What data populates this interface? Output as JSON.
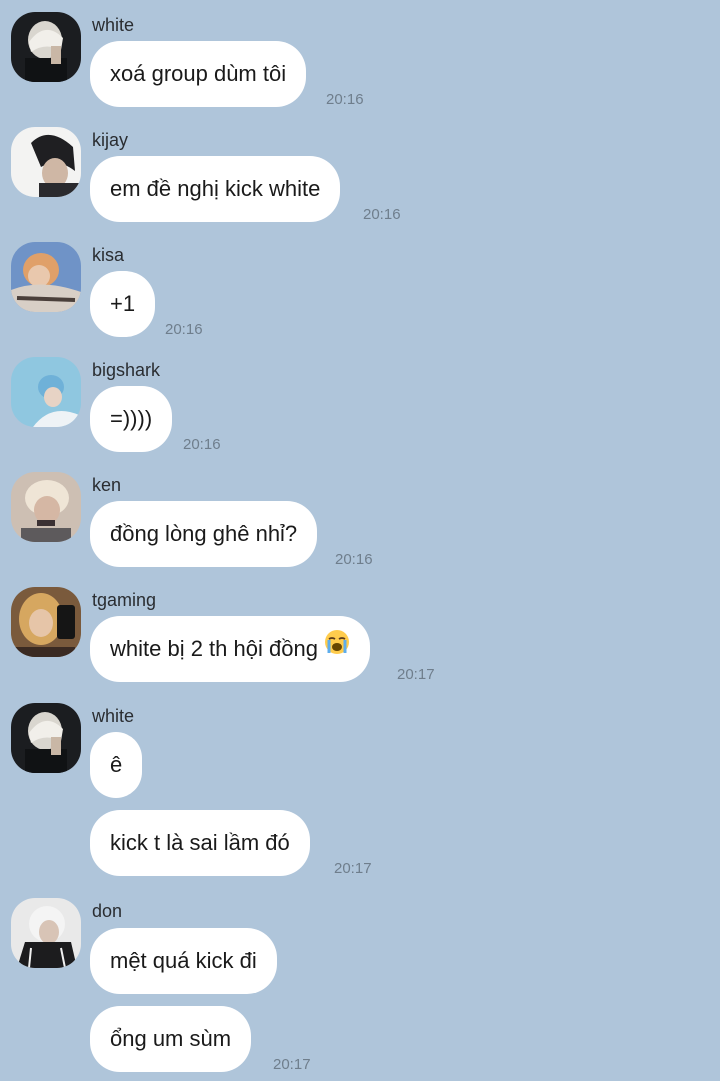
{
  "messages": [
    {
      "sender": "white",
      "texts": [
        "xoá group dùm tôi"
      ],
      "time": "20:16"
    },
    {
      "sender": "kijay",
      "texts": [
        "em đề nghị kick white"
      ],
      "time": "20:16"
    },
    {
      "sender": "kisa",
      "texts": [
        "+1"
      ],
      "time": "20:16"
    },
    {
      "sender": "bigshark",
      "texts": [
        "=))))"
      ],
      "time": "20:16"
    },
    {
      "sender": "ken",
      "texts": [
        "đồng lòng ghê nhỉ?"
      ],
      "time": "20:16"
    },
    {
      "sender": "tgaming",
      "texts": [
        "white bị 2 th hội đồng"
      ],
      "emoji": "loudly-crying-face-emoji",
      "time": "20:17"
    },
    {
      "sender": "white",
      "texts": [
        "ê",
        "kick t là sai lầm đó"
      ],
      "time": "20:17"
    },
    {
      "sender": "don",
      "texts": [
        "mệt quá kick đi",
        "ổng um sùm"
      ],
      "time": "20:17"
    }
  ],
  "colors": {
    "background": "#afc5da",
    "bubble": "#ffffff",
    "timestamp": "#6f7e8c",
    "sender": "#2a2d31"
  }
}
